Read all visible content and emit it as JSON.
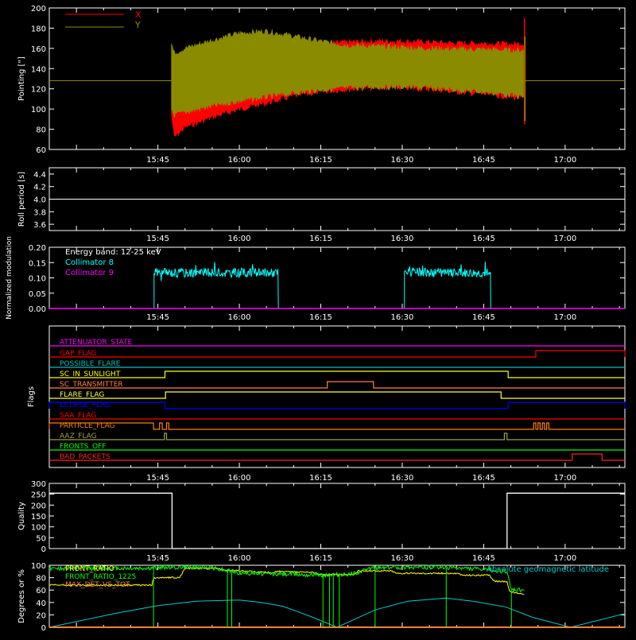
{
  "colors": {
    "background": "#000000",
    "axes": "#ffffff",
    "x_series": "#ff0000",
    "y_series": "#8b8b00",
    "collimator8": "#00ffff",
    "collimator9": "#ff00ff",
    "latitude": "#00cccc",
    "front_ratio": "#ffff00",
    "front_ratio_1225": "#00ff00",
    "max_det": "#ff8040"
  },
  "x_axis": {
    "tick_labels": [
      "15:45",
      "16:00",
      "16:15",
      "16:30",
      "16:45",
      "17:00"
    ],
    "tick_minutes": [
      945,
      960,
      975,
      990,
      1005,
      1020
    ],
    "range_minutes": [
      925,
      1031
    ]
  },
  "chart_data": [
    {
      "id": "pointing",
      "type": "area",
      "ylabel": "Pointing [\"]",
      "ylim": [
        60,
        200
      ],
      "yticks": [
        60,
        80,
        100,
        120,
        140,
        160,
        180,
        200
      ],
      "legend": [
        "X",
        "Y"
      ],
      "baseline_value": 128,
      "series": [
        {
          "name": "X",
          "color_key": "x_series",
          "x": [
            947.5,
            948,
            950,
            955,
            960,
            965,
            970,
            975,
            980,
            985,
            990,
            995,
            1000,
            1005,
            1010,
            1012.5
          ],
          "upper": [
            163,
            150,
            154,
            156,
            157,
            158,
            161,
            164,
            166,
            167,
            167,
            166,
            165,
            165,
            164,
            165
          ],
          "lower": [
            95,
            72,
            82,
            92,
            100,
            106,
            113,
            117,
            120,
            121,
            121,
            120,
            117,
            115,
            112,
            110
          ]
        },
        {
          "name": "Y",
          "color_key": "y_series",
          "x": [
            947.5,
            948,
            950,
            955,
            960,
            965,
            970,
            975,
            980,
            985,
            990,
            995,
            1000,
            1005,
            1010,
            1012.5
          ],
          "upper": [
            165,
            155,
            160,
            168,
            175,
            177,
            172,
            167,
            163,
            162,
            161,
            160,
            159,
            159,
            158,
            158
          ],
          "lower": [
            100,
            94,
            97,
            103,
            108,
            112,
            116,
            119,
            121,
            122,
            122,
            121,
            119,
            117,
            114,
            112
          ]
        }
      ]
    },
    {
      "id": "roll_period",
      "type": "line",
      "ylabel": "Roll period [s]",
      "ylim": [
        3.5,
        4.5
      ],
      "yticks": [
        3.6,
        3.8,
        4.0,
        4.2,
        4.4
      ],
      "ytick_labels": [
        "3.6",
        "3.8",
        "4.0",
        "4.2",
        "4.4"
      ],
      "series": [
        {
          "name": "",
          "x": [
            925,
            1031
          ],
          "y": [
            4.0,
            4.0
          ]
        }
      ]
    },
    {
      "id": "modulation",
      "type": "line",
      "ylabel": "Normalized modulation",
      "ylim": [
        0,
        0.2
      ],
      "yticks": [
        0,
        0.05,
        0.1,
        0.15,
        0.2
      ],
      "ytick_labels": [
        "0.00",
        "0.05",
        "0.10",
        "0.15",
        "0.20"
      ],
      "annotation": "Energy band: 12-25 keV",
      "series": [
        {
          "name": "Collimator 8",
          "color_key": "collimator8",
          "segments": [
            [
              944.3,
              967.2
            ],
            [
              990.4,
              1006.3
            ]
          ],
          "mean": 0.117,
          "noise": 0.015
        },
        {
          "name": "Collimator 9",
          "color_key": "collimator9",
          "x": [
            925,
            1031
          ],
          "y": [
            0,
            0
          ]
        }
      ]
    },
    {
      "id": "flags",
      "type": "line",
      "ylabel": "Flags",
      "series": [
        {
          "name": "ATTENUATOR_STATE",
          "color": "#ff00ff",
          "baseline": 435,
          "step": 8,
          "high": []
        },
        {
          "name": "GAP_FLAG",
          "color": "#ff0000",
          "baseline": 449,
          "step": 8,
          "high": [
            [
              1014.6,
              1031
            ]
          ]
        },
        {
          "name": "POSSIBLE_FLARE",
          "color": "#00c0c0",
          "baseline": 462,
          "step": 8,
          "high": []
        },
        {
          "name": "SC_IN_SUNLIGHT",
          "color": "#ffff00",
          "baseline": 475,
          "step": 8,
          "high": [
            [
              946.3,
              1009.5
            ]
          ]
        },
        {
          "name": "SC_TRANSMITTER",
          "color": "#ff8040",
          "baseline": 488,
          "step": 8,
          "high": [
            [
              976.2,
              984.7
            ]
          ]
        },
        {
          "name": "FLARE_FLAG",
          "color": "#ffff40",
          "baseline": 501,
          "step": 8,
          "high": [
            [
              946.4,
              1008.2
            ]
          ]
        },
        {
          "name": "ECLIPSE_FLAG",
          "color": "#0000ff",
          "baseline": 514,
          "step": 8,
          "high": [
            [
              925,
              946.3
            ],
            [
              1009.5,
              1031
            ]
          ]
        },
        {
          "name": "SAA_FLAG",
          "color": "#ff0000",
          "baseline": 527,
          "step": 8,
          "high": []
        },
        {
          "name": "PARTICLE_FLAG",
          "color": "#ff8000",
          "baseline": 540,
          "step": 8,
          "high": [
            [
              925,
              944.2
            ],
            [
              945.3,
              945.8
            ],
            [
              946.6,
              947.0
            ],
            [
              1014.2,
              1014.6
            ],
            [
              1015.0,
              1015.4
            ],
            [
              1015.8,
              1016.2
            ],
            [
              1016.6,
              1017.0
            ]
          ]
        },
        {
          "name": "AAZ_FLAG",
          "color": "#a0a040",
          "baseline": 553,
          "step": 8,
          "high": [
            [
              946.2,
              946.6
            ],
            [
              1008.8,
              1009.3
            ]
          ]
        },
        {
          "name": "FRONTS_OFF",
          "color": "#00ff00",
          "baseline": 566,
          "step": 8,
          "high": []
        },
        {
          "name": "BAD_PACKETS",
          "color": "#ff2020",
          "baseline": 579,
          "step": 8,
          "high": [
            [
              1021.3,
              1026.8
            ]
          ]
        }
      ]
    },
    {
      "id": "quality",
      "type": "line",
      "ylabel": "Quality",
      "ylim": [
        0,
        300
      ],
      "yticks": [
        0,
        50,
        100,
        150,
        200,
        250,
        300
      ],
      "series": [
        {
          "name": "",
          "x": [
            925,
            947.6,
            947.6,
            1009.3,
            1009.3,
            1031
          ],
          "y": [
            255,
            255,
            0,
            0,
            255,
            255
          ]
        }
      ]
    },
    {
      "id": "ratios",
      "type": "line",
      "ylabel": "Degrees or %",
      "ylim": [
        0,
        100
      ],
      "yticks": [
        0,
        20,
        40,
        60,
        80,
        100
      ],
      "annotation": "Absolute geomagnetic latitude",
      "series": [
        {
          "name": "FRONT_RATIO",
          "color_key": "front_ratio",
          "x": [
            925,
            944,
            944.1,
            949,
            950,
            956,
            957,
            958,
            966,
            967,
            974,
            975,
            981,
            982,
            988,
            989,
            1000,
            1001,
            1006,
            1007,
            1009.3,
            1009.8,
            1012.5
          ],
          "y": [
            68,
            68,
            80,
            80,
            95,
            95,
            93,
            92,
            88,
            90,
            88,
            85,
            85,
            91,
            91,
            87,
            87,
            84,
            84,
            74,
            74,
            57,
            54
          ]
        },
        {
          "name": "FRONT_RATIO_1225",
          "color_key": "front_ratio_1225",
          "x": [
            925,
            944,
            947,
            955,
            960,
            965,
            970,
            975,
            980,
            985,
            990,
            995,
            1000,
            1005,
            1009.3,
            1010,
            1012.5
          ],
          "y": [
            95,
            95,
            97,
            96,
            88,
            86,
            86,
            84,
            85,
            96,
            97,
            97,
            96,
            93,
            90,
            60,
            60
          ],
          "dips": [
            944.2,
            957.8,
            958.6,
            975.4,
            976.6,
            977.3,
            978.4,
            985.0,
            998.1,
            1010.1
          ]
        },
        {
          "name": "MAX_DET_VS_TOT",
          "color_key": "max_det",
          "x": [
            925,
            1031
          ],
          "y": [
            0,
            0
          ]
        },
        {
          "name": "",
          "color_key": "latitude",
          "x": [
            925,
            937,
            945,
            952,
            960,
            964,
            968,
            973,
            978,
            985,
            991,
            998,
            1003,
            1009,
            1014,
            1021,
            1031
          ],
          "y": [
            0,
            22,
            35,
            42,
            44,
            40,
            34,
            18,
            0,
            28,
            42,
            47,
            42,
            33,
            16,
            0,
            22
          ]
        }
      ]
    }
  ]
}
